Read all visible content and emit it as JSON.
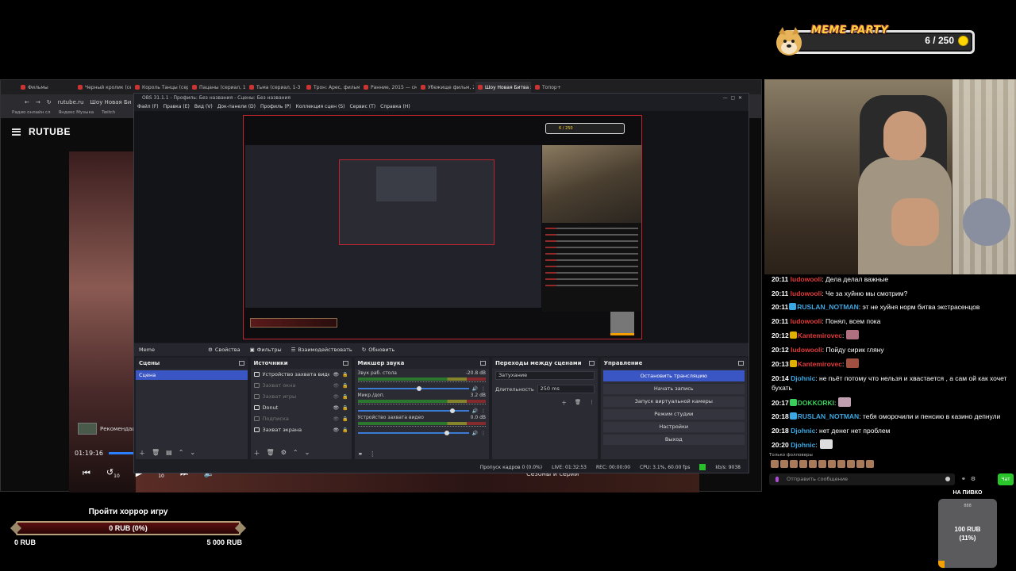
{
  "meme": {
    "title": "MEME PARTY",
    "count": "6 / 250"
  },
  "browser": {
    "tabs": [
      "Фильмы",
      "Черный кролик (сер",
      "Король Танцы (сер",
      "Пацаны (сериал, 1",
      "Тьма (сериал, 1-3",
      "Трон: Арес, фильм",
      "Ранние, 2015 — смо",
      "Убежище фильм, 202",
      "Шоу Новая Битва э",
      "Топор+"
    ],
    "active_tab": 8,
    "address": "rutube.ru",
    "page_title": "Шоу Новая Би",
    "bookmarks": [
      "Радио онлайн сл",
      "Яндекс Музыка",
      "Twitch"
    ],
    "logo": "RUTUBE",
    "reco_label": "Рекомендаци",
    "time": "01:19:16",
    "skip_back": "10",
    "skip_fwd": "10",
    "seasons": "Сезоны и серии"
  },
  "obs": {
    "title": "OBS 31.1.1 - Профиль: Без названия - Сцены: Без названия",
    "menu": [
      "Файл (F)",
      "Правка (E)",
      "Вид (V)",
      "Док-панели (D)",
      "Профиль (P)",
      "Коллекция сцен (S)",
      "Сервис (T)",
      "Справка (H)"
    ],
    "scene_bar": {
      "current": "Meme",
      "props": "Свойства",
      "filters": "Фильтры",
      "interact": "Взаимодействовать",
      "refresh": "Обновить"
    },
    "scenes": {
      "title": "Сцены",
      "items": [
        "Сцена"
      ]
    },
    "sources": {
      "title": "Источники",
      "items": [
        {
          "name": "Устройство захвата видео",
          "dim": false
        },
        {
          "name": "Захват окна",
          "dim": true
        },
        {
          "name": "Захват игры",
          "dim": true
        },
        {
          "name": "Donut",
          "dim": false
        },
        {
          "name": "Подпиcка",
          "dim": true
        },
        {
          "name": "Захват экрана",
          "dim": false
        }
      ]
    },
    "mixer": {
      "title": "Микшер звука",
      "channels": [
        {
          "name": "Звук раб. стола",
          "db": "-20.8 dB",
          "level": 0.55
        },
        {
          "name": "Микр./доп.",
          "db": "3.2 dB",
          "level": 0.85
        },
        {
          "name": "Устройство захвата видео",
          "db": "0.0 dB",
          "level": 0.8
        }
      ]
    },
    "transitions": {
      "title": "Переходы между сценами",
      "type": "Затухание",
      "duration_label": "Длительность",
      "duration": "250 ms"
    },
    "controls": {
      "title": "Управление",
      "buttons": [
        "Остановить трансляцию",
        "Начать запись",
        "Запуск виртуальной камеры",
        "Режим студии",
        "Настройки",
        "Выход"
      ]
    },
    "status": {
      "dropped": "Пропуск кадров 0 (0.0%)",
      "live": "LIVE: 01:32:53",
      "rec": "REC: 00:00:00",
      "cpu": "CPU: 3.1%, 60.00 fps",
      "kbps": "kb/s: 9038"
    }
  },
  "chat": {
    "messages": [
      {
        "time": "20:11",
        "user": "ludowooli",
        "user_color": "#e23b3b",
        "text": ": Дела делал важные"
      },
      {
        "time": "20:11",
        "user": "ludowooli",
        "user_color": "#e23b3b",
        "text": ": Че за хуйню мы смотрим?"
      },
      {
        "time": "20:11",
        "user": "RUSLAN_NOTMAN",
        "user_color": "#3ba7e2",
        "badge": "#3ba7e2",
        "text": ": эт не хуйня норм битва экстрасенцов"
      },
      {
        "time": "20:11",
        "user": "ludowooli",
        "user_color": "#e23b3b",
        "text": ": Понял, всем пока"
      },
      {
        "time": "20:12",
        "user": "Kantemirovec",
        "user_color": "#e23b3b",
        "badge": "#e0b000",
        "text": ":",
        "emote": "#b07080"
      },
      {
        "time": "20:12",
        "user": "ludowooli",
        "user_color": "#e23b3b",
        "text": ": Пойду сирик гляну"
      },
      {
        "time": "20:13",
        "user": "Kantemirovec",
        "user_color": "#e23b3b",
        "badge": "#e0b000",
        "text": ":",
        "emote": "#a05040"
      },
      {
        "time": "20:14",
        "user": "Djohnic",
        "user_color": "#3ba7e2",
        "text": ": не пьёт потому что нельзя и хвастается , а сам ой как хочет бухать"
      },
      {
        "time": "20:17",
        "user": "DOKKORKI",
        "user_color": "#38d05a",
        "badge": "#38d05a",
        "text": ":",
        "emote": "#c0a0b0"
      },
      {
        "time": "20:18",
        "user": "RUSLAN_NOTMAN",
        "user_color": "#3ba7e2",
        "badge": "#3ba7e2",
        "text": ": тебя оморочили и пенсию в казино депнули"
      },
      {
        "time": "20:18",
        "user": "Djohnic",
        "user_color": "#3ba7e2",
        "text": ": нет денег нет проблем"
      },
      {
        "time": "20:20",
        "user": "Djohnic",
        "user_color": "#3ba7e2",
        "text": ":",
        "emote": "#dddddd"
      }
    ],
    "followers_only": "Только фолловеры",
    "placeholder": "Отправить сообщение",
    "chat_button": "Чат"
  },
  "goal": {
    "title": "Пройти хоррор игру",
    "value": "0 RUB (0%)",
    "min": "0 RUB",
    "max": "5 000 RUB",
    "progress": 0
  },
  "beer": {
    "title": "НА ПИВКО",
    "sub": "888",
    "value": "100 RUB",
    "percent": "(11%)",
    "progress": 0.11
  }
}
